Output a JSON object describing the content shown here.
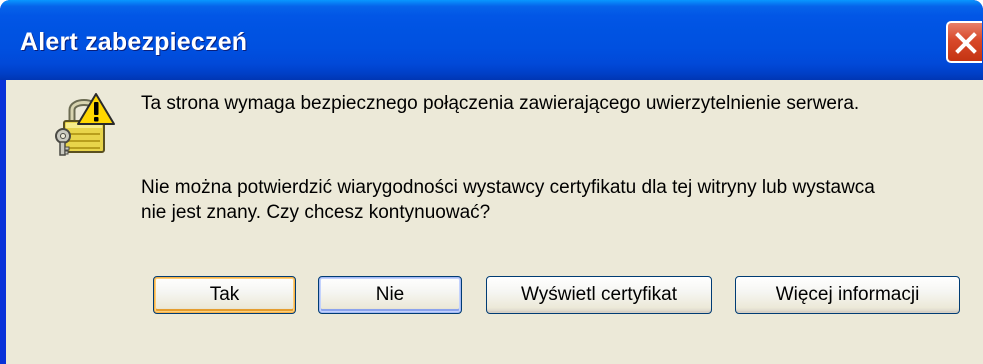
{
  "window": {
    "title": "Alert zabezpieczeń",
    "close_icon": "close-icon",
    "colors": {
      "titlebar": "#0053e2",
      "body": "#ece9d8",
      "close": "#d8492a"
    }
  },
  "message": {
    "icon": "security-lock-warning-icon",
    "line1": "Ta strona wymaga bezpiecznego połączenia zawierającego uwierzytelnienie serwera.",
    "line2a": "Nie można potwierdzić wiarygodności wystawcy certyfikatu dla tej witryny lub wystawca",
    "line2b": "nie jest znany. Czy chcesz kontynuować?"
  },
  "buttons": {
    "yes": "Tak",
    "no": "Nie",
    "view_certificate": "Wyświetl certyfikat",
    "more_info": "Więcej informacji"
  }
}
